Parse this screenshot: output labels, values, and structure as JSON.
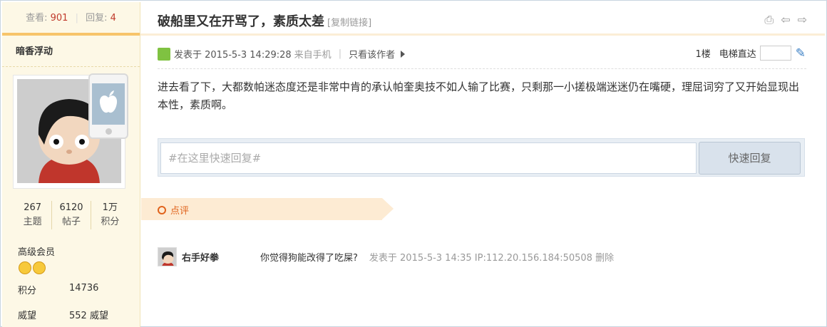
{
  "stats": {
    "views_label": "查看:",
    "views": "901",
    "replies_label": "回复:",
    "replies": "4"
  },
  "author": {
    "name": "暗香浮动",
    "topics": "267",
    "topics_label": "主题",
    "posts": "6120",
    "posts_label": "帖子",
    "points_short": "1万",
    "points_short_label": "积分",
    "level": "高级会员",
    "score_label": "积分",
    "score": "14736",
    "prestige_label": "威望",
    "prestige": "552 威望"
  },
  "post": {
    "title": "破船里又在开骂了，素质太差",
    "copy_link": "[复制链接]",
    "posted_prefix": "发表于 2015-5-3 14:29:28",
    "from": "来自手机",
    "only_author": "只看该作者",
    "floor": "1楼",
    "elevator": "电梯直达",
    "content": "进去看了下，大都数帕迷态度还是非常中肯的承认帕奎奥技不如人输了比赛，只剩那一小搓极端迷迷仍在嘴硬，理屈词穷了又开始显现出本性，素质啊。"
  },
  "quick_reply": {
    "placeholder": "#在这里快速回复#",
    "button": "快速回复"
  },
  "review": {
    "label": "点评"
  },
  "comment": {
    "user": "右手好拳",
    "text": "你觉得狗能改得了吃屎?",
    "meta": "发表于 2015-5-3 14:35 IP:112.20.156.184:50508 删除"
  },
  "colors": {
    "accent": "#e0631c",
    "sidebar_bg": "#fdf8e6",
    "num_red": "#c0392b"
  }
}
